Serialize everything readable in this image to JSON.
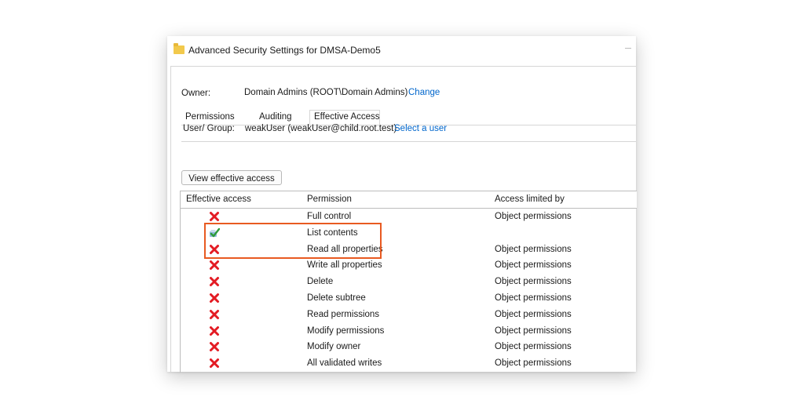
{
  "window": {
    "title": "Advanced Security Settings for DMSA-Demo5"
  },
  "owner": {
    "label": "Owner:",
    "value": "Domain Admins (ROOT\\Domain Admins)",
    "change_link": "Change"
  },
  "tabs": [
    {
      "label": "Permissions",
      "active": false
    },
    {
      "label": "Auditing",
      "active": false
    },
    {
      "label": "Effective Access",
      "active": true
    }
  ],
  "user_group": {
    "label": "User/ Group:",
    "value": "weakUser (weakUser@child.root.test)",
    "select_link": "Select a user"
  },
  "view_button": "View effective access",
  "table": {
    "headers": [
      "Effective access",
      "Permission",
      "Access limited by"
    ],
    "rows": [
      {
        "icon": "red-x-icon",
        "permission": "Full control",
        "limited_by": "Object permissions"
      },
      {
        "icon": "green-check-icon",
        "permission": "List contents",
        "limited_by": ""
      },
      {
        "icon": "red-x-icon",
        "permission": "Read all properties",
        "limited_by": "Object permissions"
      },
      {
        "icon": "red-x-icon",
        "permission": "Write all properties",
        "limited_by": "Object permissions"
      },
      {
        "icon": "red-x-icon",
        "permission": "Delete",
        "limited_by": "Object permissions"
      },
      {
        "icon": "red-x-icon",
        "permission": "Delete subtree",
        "limited_by": "Object permissions"
      },
      {
        "icon": "red-x-icon",
        "permission": "Read permissions",
        "limited_by": "Object permissions"
      },
      {
        "icon": "red-x-icon",
        "permission": "Modify permissions",
        "limited_by": "Object permissions"
      },
      {
        "icon": "red-x-icon",
        "permission": "Modify owner",
        "limited_by": "Object permissions"
      },
      {
        "icon": "red-x-icon",
        "permission": "All validated writes",
        "limited_by": "Object permissions"
      }
    ]
  },
  "colors": {
    "highlight": "#e85a21",
    "deny": "#e31b23",
    "allow": "#2e9b3a",
    "link": "#0066cc"
  }
}
